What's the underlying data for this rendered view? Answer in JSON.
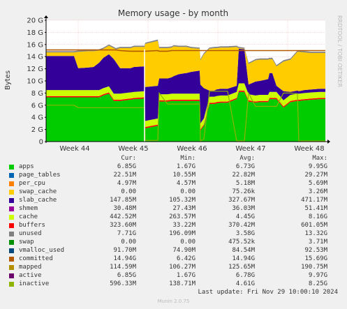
{
  "colors": {
    "apps": "#00cc00",
    "page_tables": "#0066b3",
    "per_cpu": "#ff8000",
    "swap_cache": "#ffcc00",
    "slab_cache": "#330099",
    "shmem": "#990099",
    "cache": "#ccff00",
    "buffers": "#ff0000",
    "unused": "#808080",
    "swap": "#008f00",
    "vmalloc_used": "#00487d",
    "committed": "#b35a00",
    "mapped": "#b38f00",
    "active": "#6b006b",
    "inactive": "#8fb300"
  },
  "chart_data": {
    "type": "area",
    "title": "Memory usage - by month",
    "ylabel": "Bytes",
    "side_label": "RRDTOOL / TOBI OETIKER",
    "ylim": [
      0,
      20
    ],
    "yticks": [
      "0",
      "2 G",
      "4 G",
      "6 G",
      "8 G",
      "10 G",
      "12 G",
      "14 G",
      "16 G",
      "18 G",
      "20 G"
    ],
    "xticks": [
      "Week 44",
      "Week 45",
      "Week 46",
      "Week 47",
      "Week 48"
    ],
    "grid": true,
    "x": [
      0,
      1,
      1.3,
      2,
      2.3,
      3,
      3.4,
      3.8,
      4.1,
      4.5,
      4.85,
      5,
      5.3,
      6,
      6.05,
      6.3,
      7.05,
      7.1,
      8,
      8.1,
      8.7,
      9,
      9.15,
      9.5,
      10,
      10.05,
      10.4,
      11,
      11.05,
      11.3,
      11.7,
      12.05,
      12.2,
      12.5,
      13,
      13.65,
      13.8,
      14.2,
      14.5,
      15,
      15.3,
      15.9,
      16,
      16.2,
      16.5,
      17,
      17.5,
      18,
      18.1,
      18.5,
      19,
      19.6,
      20
    ],
    "series": [
      {
        "name": "apps",
        "values": [
          7.3,
          7.3,
          7.3,
          7.3,
          7.3,
          7.3,
          7.3,
          7.3,
          7.6,
          7.9,
          6.7,
          6.7,
          6.7,
          6.9,
          6.9,
          7.0,
          7.1,
          2.2,
          2.6,
          6.6,
          6.6,
          6.7,
          6.7,
          6.7,
          6.7,
          6.7,
          6.7,
          6.7,
          1.8,
          2.6,
          6.2,
          6.2,
          6.3,
          6.4,
          6.4,
          7.0,
          8.2,
          8.2,
          6.6,
          6.4,
          6.5,
          6.5,
          7.0,
          7.0,
          7.0,
          5.6,
          6.5,
          6.7,
          6.7,
          6.8,
          6.9,
          7.0,
          7.0
        ]
      },
      {
        "name": "buffers",
        "values": [
          0.2,
          0.2,
          0.2,
          0.2,
          0.2,
          0.2,
          0.2,
          0.2,
          0.2,
          0.2,
          0.2,
          0.2,
          0.2,
          0.2,
          0.2,
          0.2,
          0.2,
          0.2,
          0.2,
          0.2,
          0.2,
          0.2,
          0.2,
          0.2,
          0.2,
          0.2,
          0.2,
          0.2,
          0.2,
          0.2,
          0.2,
          0.2,
          0.2,
          0.2,
          0.2,
          0.2,
          0.2,
          0.2,
          0.2,
          0.2,
          0.2,
          0.2,
          0.2,
          0.2,
          0.2,
          0.2,
          0.2,
          0.2,
          0.2,
          0.2,
          0.2,
          0.2,
          0.2
        ]
      },
      {
        "name": "cache",
        "values": [
          1.0,
          1.0,
          1.0,
          1.0,
          1.0,
          1.0,
          1.0,
          1.0,
          1.0,
          1.0,
          1.0,
          1.0,
          1.0,
          1.0,
          1.0,
          1.0,
          1.0,
          1.0,
          1.0,
          1.0,
          1.0,
          1.0,
          1.0,
          1.0,
          1.0,
          1.0,
          1.0,
          1.0,
          1.0,
          1.0,
          1.0,
          1.0,
          1.0,
          1.0,
          1.0,
          1.0,
          1.2,
          1.2,
          1.0,
          1.0,
          1.0,
          1.0,
          1.0,
          1.0,
          1.0,
          1.0,
          1.0,
          1.0,
          1.0,
          1.0,
          1.0,
          1.0,
          1.0
        ]
      },
      {
        "name": "slab_cache",
        "values": [
          5.6,
          5.6,
          5.6,
          5.6,
          3.6,
          3.7,
          3.8,
          4.5,
          5.0,
          5.3,
          5.7,
          5.2,
          4.2,
          4.0,
          4.0,
          4.1,
          4.1,
          5.6,
          5.4,
          2.6,
          2.6,
          2.7,
          2.9,
          3.2,
          3.4,
          3.4,
          3.6,
          3.8,
          6.4,
          5.0,
          1.0,
          1.0,
          1.1,
          1.1,
          1.1,
          1.0,
          5.7,
          5.6,
          1.6,
          2.3,
          2.3,
          2.6,
          3.1,
          3.1,
          1.0,
          1.5,
          0.5,
          0.5,
          0.4,
          0.5,
          0.5,
          0.5,
          0.5
        ]
      },
      {
        "name": "swap_cache",
        "values": [
          0.6,
          0.6,
          0.6,
          0.6,
          2.7,
          2.7,
          2.6,
          2.0,
          1.5,
          1.4,
          1.8,
          2.1,
          3.3,
          3.3,
          3.3,
          3.3,
          3.2,
          7.1,
          7.4,
          5.0,
          5.0,
          4.9,
          4.9,
          4.5,
          4.3,
          4.3,
          3.9,
          3.6,
          4.0,
          5.6,
          6.9,
          7.0,
          6.8,
          6.8,
          6.8,
          6.4,
          0.1,
          0.1,
          3.4,
          3.5,
          3.5,
          3.2,
          2.3,
          2.3,
          3.2,
          4.9,
          5.3,
          6.4,
          6.5,
          6.2,
          6.0,
          5.9,
          5.9
        ]
      },
      {
        "name": "unused",
        "values": [
          0.2,
          0.2,
          0.2,
          0.2,
          0.2,
          0.2,
          0.2,
          0.2,
          0.2,
          0.2,
          0.2,
          0.2,
          0.2,
          0.2,
          0.2,
          0.2,
          0.2,
          0.2,
          0.2,
          0.2,
          0.2,
          0.2,
          0.2,
          0.2,
          0.2,
          0.2,
          0.2,
          0.2,
          0.2,
          0.2,
          0.2,
          0.2,
          0.2,
          0.2,
          0.2,
          0.2,
          0.2,
          0.2,
          0.2,
          0.2,
          0.2,
          0.2,
          0.2,
          0.2,
          0.2,
          0.2,
          0.2,
          0.2,
          0.2,
          0.2,
          0.2,
          0.2,
          0.2
        ]
      }
    ],
    "overlay_series": [
      {
        "name": "committed",
        "values": [
          15.1,
          15.1,
          15.1,
          15.1,
          15.1,
          15.1,
          15.1,
          15.1,
          15.1,
          15.1,
          15.1,
          15.1,
          15.0,
          14.9,
          14.9,
          14.9,
          14.9,
          14.9,
          15.0,
          14.9,
          14.9,
          15.0,
          15.0,
          15.0,
          15.0,
          15.0,
          15.0,
          15.0,
          15.0,
          15.0,
          15.0,
          15.0,
          15.0,
          15.0,
          15.0,
          15.0,
          15.0,
          15.0,
          15.0,
          15.0,
          15.0,
          15.0,
          15.0,
          15.0,
          15.0,
          15.0,
          15.0,
          15.0,
          15.0,
          15.0,
          15.0,
          15.0,
          15.0
        ]
      },
      {
        "name": "inactive",
        "values": [
          6.0,
          6.0,
          6.0,
          6.0,
          5.6,
          5.6,
          5.6,
          5.6,
          5.6,
          5.6,
          5.6,
          5.6,
          5.6,
          5.6,
          5.6,
          5.6,
          5.6,
          0.2,
          0.2,
          8.0,
          6.2,
          6.2,
          6.2,
          6.2,
          6.2,
          6.2,
          6.2,
          6.2,
          0.1,
          0.4,
          8.3,
          8.3,
          8.3,
          8.3,
          8.3,
          0.1,
          0.1,
          0.1,
          8.0,
          5.8,
          5.8,
          5.8,
          5.8,
          5.8,
          5.8,
          8.0,
          8.0,
          7.9,
          0.1,
          0.1,
          0.1,
          0.1,
          0.1
        ]
      }
    ],
    "cursor_x": 7.05
  },
  "legend": {
    "headers": {
      "cur": "Cur:",
      "min": "Min:",
      "avg": "Avg:",
      "max": "Max:"
    },
    "rows": [
      {
        "key": "apps",
        "name": "apps",
        "cur": "6.85G",
        "min": "1.67G",
        "avg": "6.73G",
        "max": "9.95G"
      },
      {
        "key": "page_tables",
        "name": "page_tables",
        "cur": "22.51M",
        "min": "10.55M",
        "avg": "22.82M",
        "max": "29.27M"
      },
      {
        "key": "per_cpu",
        "name": "per_cpu",
        "cur": "4.97M",
        "min": "4.57M",
        "avg": "5.18M",
        "max": "5.69M"
      },
      {
        "key": "swap_cache",
        "name": "swap_cache",
        "cur": "0.00",
        "min": "0.00",
        "avg": "75.26k",
        "max": "3.26M"
      },
      {
        "key": "slab_cache",
        "name": "slab_cache",
        "cur": "147.85M",
        "min": "105.32M",
        "avg": "327.67M",
        "max": "471.17M"
      },
      {
        "key": "shmem",
        "name": "shmem",
        "cur": "30.48M",
        "min": "27.43M",
        "avg": "36.03M",
        "max": "51.41M"
      },
      {
        "key": "cache",
        "name": "cache",
        "cur": "442.52M",
        "min": "263.57M",
        "avg": "4.45G",
        "max": "8.16G"
      },
      {
        "key": "buffers",
        "name": "buffers",
        "cur": "323.60M",
        "min": "33.22M",
        "avg": "370.42M",
        "max": "601.05M"
      },
      {
        "key": "unused",
        "name": "unused",
        "cur": "7.71G",
        "min": "196.09M",
        "avg": "3.58G",
        "max": "13.32G"
      },
      {
        "key": "swap",
        "name": "swap",
        "cur": "0.00",
        "min": "0.00",
        "avg": "475.52k",
        "max": "3.71M"
      },
      {
        "key": "vmalloc_used",
        "name": "vmalloc_used",
        "cur": "91.70M",
        "min": "74.90M",
        "avg": "84.54M",
        "max": "92.53M"
      },
      {
        "key": "committed",
        "name": "committed",
        "cur": "14.94G",
        "min": "6.42G",
        "avg": "14.94G",
        "max": "15.69G"
      },
      {
        "key": "mapped",
        "name": "mapped",
        "cur": "114.59M",
        "min": "106.27M",
        "avg": "125.65M",
        "max": "190.75M"
      },
      {
        "key": "active",
        "name": "active",
        "cur": "6.85G",
        "min": "1.67G",
        "avg": "6.78G",
        "max": "9.97G"
      },
      {
        "key": "inactive",
        "name": "inactive",
        "cur": "596.33M",
        "min": "138.71M",
        "avg": "4.61G",
        "max": "8.25G"
      }
    ]
  },
  "footer": {
    "last_update": "Last update: Fri Nov 29 10:00:10 2024",
    "munin": "Munin 2.0.75"
  }
}
